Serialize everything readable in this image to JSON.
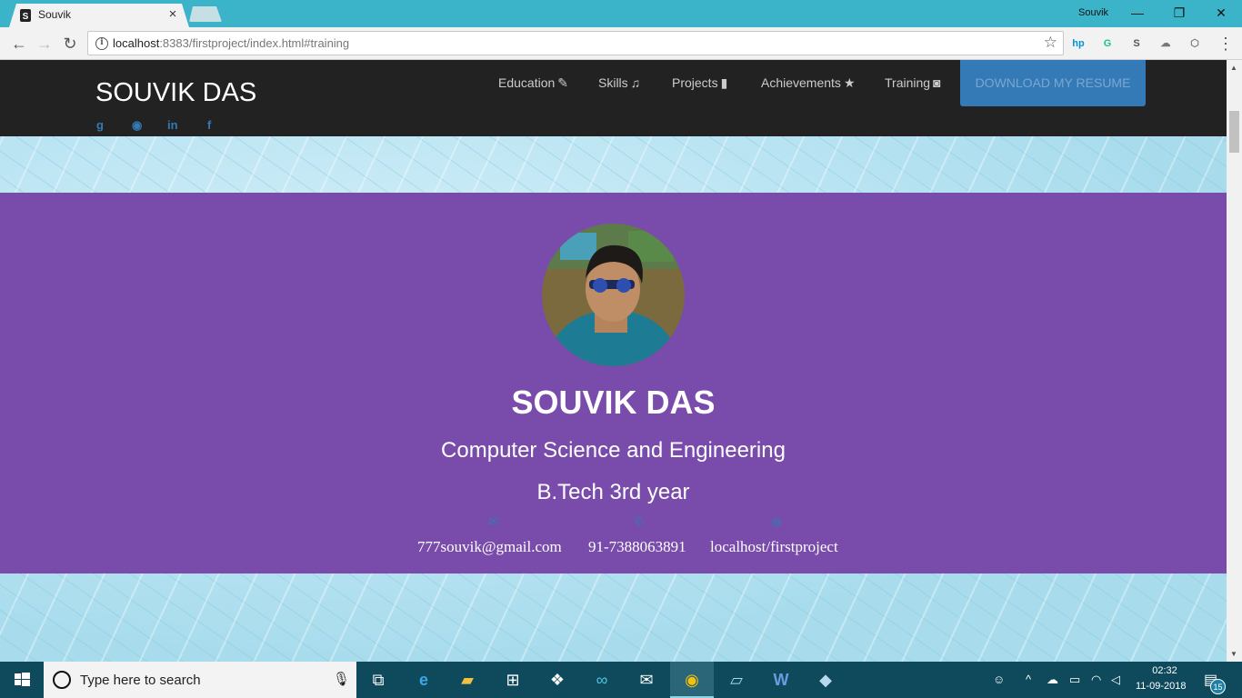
{
  "browser": {
    "tab_title": "Souvik",
    "tab_close": "×",
    "profile_name": "Souvik",
    "window_controls": {
      "minimize": "—",
      "restore": "❐",
      "close": "✕"
    },
    "back": "←",
    "forward": "→",
    "reload": "↻",
    "url_host": "localhost",
    "url_rest": ":8383/firstproject/index.html#training",
    "bookmark_star": "☆",
    "menu": "⋮",
    "extensions": [
      {
        "name": "hp-icon",
        "label": "hp",
        "color": "#0096d6"
      },
      {
        "name": "grammarly-icon",
        "label": "G",
        "color": "#15c39a"
      },
      {
        "name": "s-extension-icon",
        "label": "S",
        "color": "#555555"
      },
      {
        "name": "cloud-extension-icon",
        "label": "☁",
        "color": "#777777"
      },
      {
        "name": "box-extension-icon",
        "label": "⬡",
        "color": "#777777"
      }
    ]
  },
  "site": {
    "brand": "SOUVIK DAS",
    "social": [
      {
        "name": "google-plus-icon",
        "glyph": "g"
      },
      {
        "name": "github-icon",
        "glyph": "◉"
      },
      {
        "name": "linkedin-icon",
        "glyph": "in"
      },
      {
        "name": "facebook-icon",
        "glyph": "f"
      }
    ],
    "nav": [
      {
        "label": "Education",
        "icon": "✎",
        "icon_name": "pencil-icon"
      },
      {
        "label": "Skills",
        "icon": "♫",
        "icon_name": "music-icon"
      },
      {
        "label": "Projects",
        "icon": "▮",
        "icon_name": "file-icon"
      },
      {
        "label": "Achievements",
        "icon": "★",
        "icon_name": "star-icon"
      },
      {
        "label": "Training",
        "icon": "◙",
        "icon_name": "camera-icon"
      }
    ],
    "resume_button": "DOWNLOAD MY RESUME"
  },
  "hero": {
    "name": "SOUVIK DAS",
    "department": "Computer Science and Engineering",
    "year": "B.Tech 3rd year",
    "email_icon": "✉",
    "phone_icon": "✆",
    "web_icon": "◍",
    "email": "777souvik@gmail.com",
    "phone": "91-7388063891",
    "website": "localhost/firstproject"
  },
  "taskbar": {
    "search_placeholder": "Type here to search",
    "mic": "🎙",
    "time": "02:32",
    "date": "11-09-2018",
    "notification_count": "15"
  },
  "colors": {
    "navbar": "#222222",
    "hero": "#794bab",
    "link_blue": "#337ab7",
    "chrome_frame": "#3bb3c9",
    "taskbar": "#0e4a5c"
  }
}
